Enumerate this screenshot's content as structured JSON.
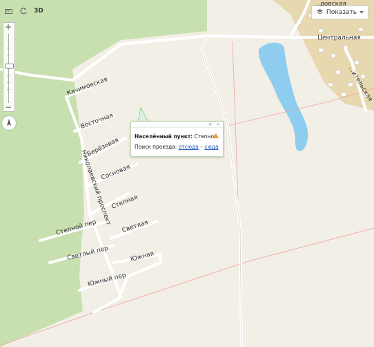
{
  "toolbar": {
    "btn_3d": "3D",
    "show_label": "Показать"
  },
  "icons": {
    "ruler": "ruler-icon",
    "rotate": "rotate-icon",
    "layers": "layers-icon",
    "compass": "compass-icon",
    "warning": "warning-icon"
  },
  "colors": {
    "forest": "#c8e0b0",
    "village": "#e8d8b0",
    "water": "#8ecdf0",
    "balloon_link": "#1a57c4",
    "warning": "#f29b2a"
  },
  "zoom": {
    "plus": "+",
    "minus": "−",
    "level_fraction": 0.45
  },
  "streets": {
    "kachimovskaya": "Качимовская",
    "vostochnaya": "Восточная",
    "beryozovaya": "Берёзовая",
    "sosnovaya": "Сосновая",
    "stepnaya": "Степная",
    "stepnoy_per": "Степной пер",
    "svetlaya": "Светлая",
    "svetly_per": "Светлый пер",
    "yuzhnaya": "Южная",
    "yuzhny_per": "Южный пер",
    "nikolaevsky": "Николаевский проспект",
    "tsentralnaya": "Центральная",
    "top_cut": "...довская",
    "right_cut": "...ительская"
  },
  "balloon": {
    "settlement_label": "Населённый пункт:",
    "settlement_name": "Степной",
    "route_label": "Поиск проезда:",
    "from_here": "отсюда",
    "dash": "–",
    "to_here": "сюда",
    "ctrl_pin": "⊳",
    "ctrl_close": "×"
  }
}
